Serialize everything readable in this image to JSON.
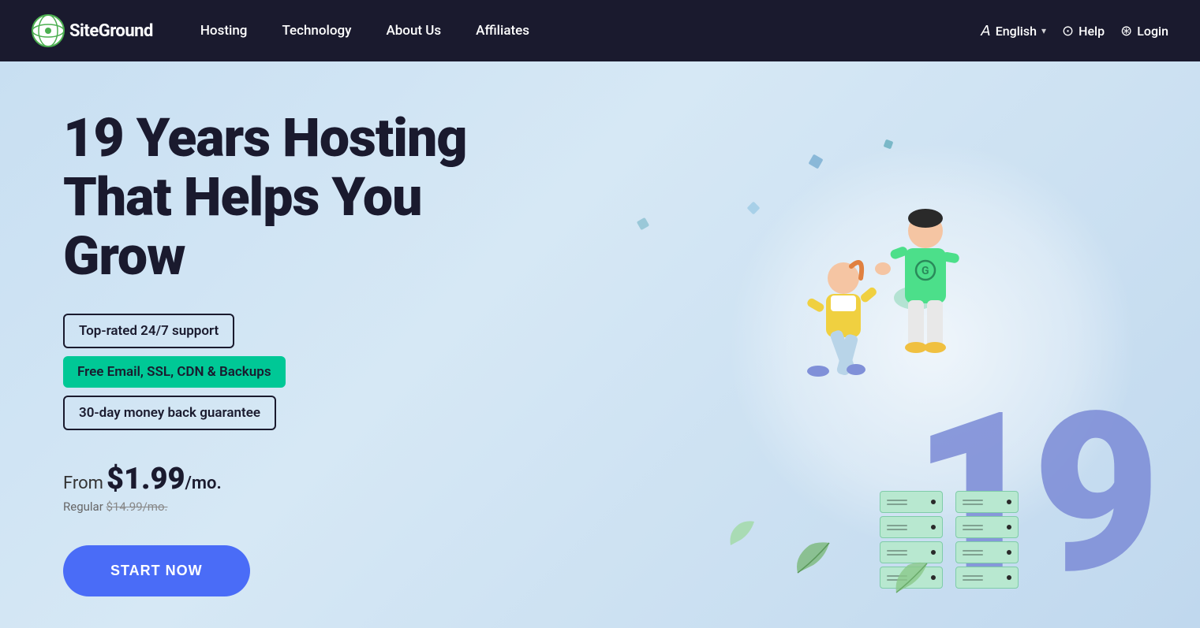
{
  "nav": {
    "logo_text": "SiteGround",
    "links": [
      {
        "label": "Hosting",
        "id": "hosting"
      },
      {
        "label": "Technology",
        "id": "technology"
      },
      {
        "label": "About Us",
        "id": "about-us"
      },
      {
        "label": "Affiliates",
        "id": "affiliates"
      }
    ],
    "right": {
      "language_label": "English",
      "help_label": "Help",
      "login_label": "Login"
    }
  },
  "hero": {
    "title_line1": "19 Years Hosting",
    "title_line2": "That Helps You Grow",
    "badge1": "Top-rated 24/7 support",
    "badge2": "Free Email, SSL, CDN & Backups",
    "badge3": "30-day money back guarantee",
    "from_label": "From",
    "price": "$1.99",
    "per_mo": "/mo.",
    "regular_label": "Regular",
    "regular_price": "$14.99/mo.",
    "cta_button": "START NOW",
    "nineteen": "19"
  },
  "colors": {
    "nav_bg": "#1a1a2e",
    "hero_bg": "#d6e8f5",
    "cta_bg": "#4a6cf7",
    "badge_green_bg": "#00c896",
    "accent_purple": "#8090d8"
  }
}
